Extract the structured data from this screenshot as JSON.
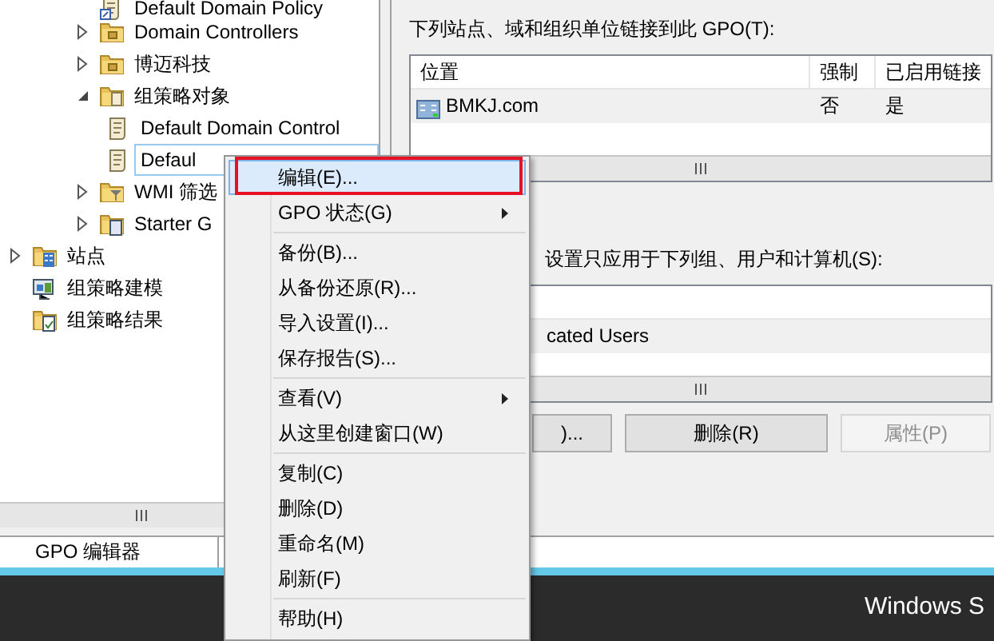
{
  "tree": {
    "domain_items": [
      {
        "label": "Default Domain Policy",
        "kind": "gpo-link",
        "selected": false
      },
      {
        "label": "Domain Controllers",
        "kind": "ou",
        "expanded": false,
        "selected": false
      },
      {
        "label": "博迈科技",
        "kind": "ou",
        "expanded": false,
        "selected": false
      },
      {
        "label": "组策略对象",
        "kind": "gpo-folder",
        "expanded": true,
        "selected": false,
        "children": [
          {
            "label": "Default Domain Control",
            "kind": "gpo",
            "selected": false
          },
          {
            "label": "Defaul",
            "kind": "gpo",
            "selected": true
          }
        ]
      },
      {
        "label": "WMI 筛选",
        "kind": "wmi",
        "expanded": false,
        "selected": false
      },
      {
        "label": "Starter G",
        "kind": "starter",
        "expanded": false,
        "selected": false
      }
    ],
    "root_items": [
      {
        "label": "站点",
        "kind": "sites",
        "expanded": false,
        "selected": false
      },
      {
        "label": "组策略建模",
        "kind": "modeling",
        "selected": false
      },
      {
        "label": "组策略结果",
        "kind": "results",
        "selected": false
      }
    ]
  },
  "links": {
    "label": "下列站点、域和组织单位链接到此 GPO(T):",
    "columns": [
      "位置",
      "强制",
      "已启用链接"
    ],
    "rows": [
      {
        "cells": [
          "BMKJ.com",
          "否",
          "是"
        ],
        "selected": true
      }
    ]
  },
  "filtering": {
    "label": "设置只应用于下列组、用户和计算机(S):",
    "rows": [
      {
        "name": "cated Users"
      }
    ],
    "buttons": [
      {
        "label": ")...",
        "disabled": false
      },
      {
        "label": "删除(R)",
        "disabled": false
      },
      {
        "label": "属性(P)",
        "disabled": true
      }
    ]
  },
  "status_bar": {
    "text": "GPO 编辑器"
  },
  "taskbar": {
    "text": "Windows S"
  },
  "context_menu": [
    {
      "kind": "item",
      "label": "编辑(E)...",
      "highlighted": true,
      "outlined": true,
      "submenu": false
    },
    {
      "kind": "item",
      "label": "GPO 状态(G)",
      "highlighted": false,
      "submenu": true
    },
    {
      "kind": "separator"
    },
    {
      "kind": "item",
      "label": "备份(B)...",
      "highlighted": false,
      "submenu": false
    },
    {
      "kind": "item",
      "label": "从备份还原(R)...",
      "highlighted": false,
      "submenu": false
    },
    {
      "kind": "item",
      "label": "导入设置(I)...",
      "highlighted": false,
      "submenu": false
    },
    {
      "kind": "item",
      "label": "保存报告(S)...",
      "highlighted": false,
      "submenu": false
    },
    {
      "kind": "separator"
    },
    {
      "kind": "item",
      "label": "查看(V)",
      "highlighted": false,
      "submenu": true
    },
    {
      "kind": "item",
      "label": "从这里创建窗口(W)",
      "highlighted": false,
      "submenu": false
    },
    {
      "kind": "separator"
    },
    {
      "kind": "item",
      "label": "复制(C)",
      "highlighted": false,
      "submenu": false
    },
    {
      "kind": "item",
      "label": "删除(D)",
      "highlighted": false,
      "submenu": false
    },
    {
      "kind": "item",
      "label": "重命名(M)",
      "highlighted": false,
      "submenu": false
    },
    {
      "kind": "item",
      "label": "刷新(F)",
      "highlighted": false,
      "submenu": false
    },
    {
      "kind": "separator"
    },
    {
      "kind": "item",
      "label": "帮助(H)",
      "highlighted": false,
      "submenu": false
    }
  ]
}
